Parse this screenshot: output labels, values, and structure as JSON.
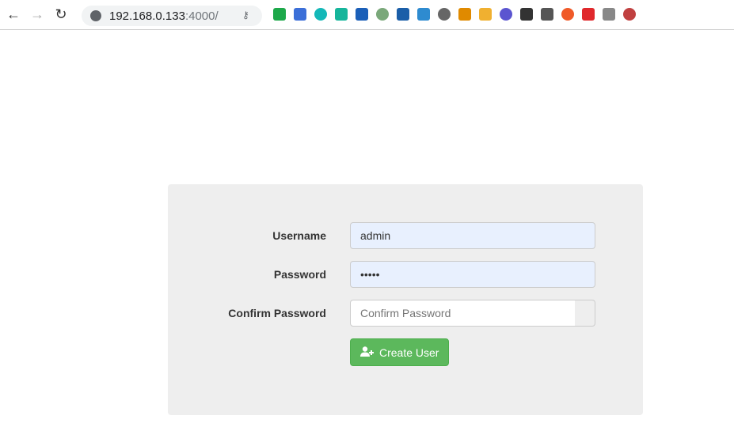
{
  "browser": {
    "url_host": "192.168.0.133",
    "url_port": ":4000/",
    "extension_colors": [
      "#1da84a",
      "#3b6fd8",
      "#14b8b8",
      "#16b59b",
      "#1b5fb8",
      "#7aa87a",
      "#1a5ea8",
      "#2e8bd0",
      "#666666",
      "#e08a00",
      "#f0b030",
      "#5b55d0",
      "#333333",
      "#555555",
      "#f05a28",
      "#e0282c",
      "#888888",
      "#c04040"
    ]
  },
  "form": {
    "username_label": "Username",
    "username_value": "admin",
    "password_label": "Password",
    "password_value": "•••••",
    "confirm_label": "Confirm Password",
    "confirm_placeholder": "Confirm Password",
    "create_label": "Create User"
  },
  "colors": {
    "button": "#5cb85c",
    "panel": "#eeeeee"
  }
}
